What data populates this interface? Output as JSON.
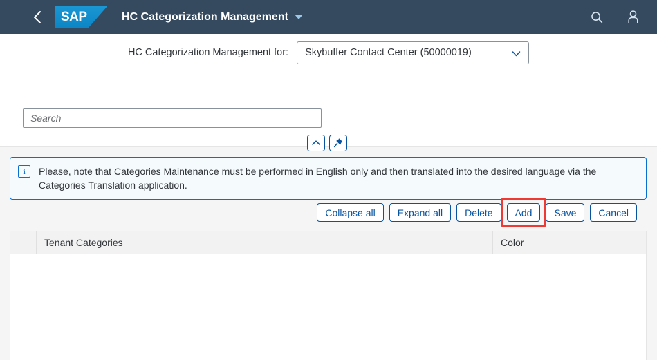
{
  "shellbar": {
    "back_icon": "back-chevron-icon",
    "logo_text": "SAP",
    "title": "HC Categorization Management",
    "title_caret_icon": "caret-down-icon",
    "search_icon": "search-icon",
    "user_icon": "user-avatar-icon"
  },
  "selector": {
    "label": "HC Categorization Management for:",
    "value": "Skybuffer Contact Center (50000019)",
    "dropdown_icon": "chevron-down-icon"
  },
  "search": {
    "value": "",
    "placeholder": "Search"
  },
  "header_controls": {
    "collapse_icon": "chevron-up-icon",
    "pin_icon": "pushpin-icon"
  },
  "message_strip": {
    "icon": "information-icon",
    "icon_glyph": "i",
    "text": "Please, note that Categories Maintenance must be performed in English only and then translated into the desired language via the Categories Translation application."
  },
  "toolbar": {
    "collapse_all_label": "Collapse all",
    "expand_all_label": "Expand all",
    "delete_label": "Delete",
    "add_label": "Add",
    "save_label": "Save",
    "cancel_label": "Cancel",
    "highlighted_button": "Add"
  },
  "table": {
    "columns": [
      {
        "key": "select",
        "header": ""
      },
      {
        "key": "tenant_categories",
        "header": "Tenant Categories"
      },
      {
        "key": "color",
        "header": "Color"
      }
    ],
    "rows": []
  },
  "colors": {
    "shell_bg": "#354a5f",
    "accent_blue": "#0854a0",
    "info_border": "#0a6ed1",
    "info_bg": "#f5fafd",
    "highlight_red": "#ee3a33",
    "page_bg": "#f5f5f5",
    "logo_blue": "#0c85c4"
  }
}
